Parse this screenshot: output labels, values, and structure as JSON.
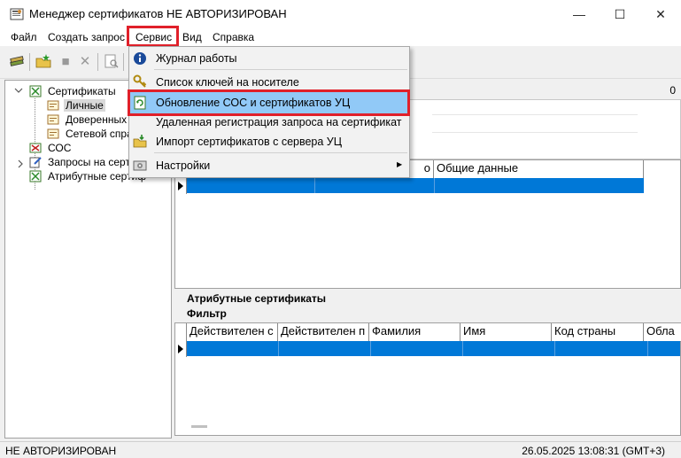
{
  "window": {
    "title": "Менеджер сертификатов  НЕ АВТОРИЗИРОВАН",
    "minimize": "—",
    "maximize": "☐",
    "close": "✕"
  },
  "menubar": [
    "Файл",
    "Создать запрос",
    "Сервис",
    "Вид",
    "Справка"
  ],
  "tree": {
    "items": [
      {
        "label": "Сертификаты",
        "icon": "certificate-folder-icon"
      },
      {
        "label": "Личные",
        "icon": "certificate-icon"
      },
      {
        "label": "Доверенных У",
        "icon": "certificate-icon"
      },
      {
        "label": "Сетевой справ",
        "icon": "certificate-icon"
      },
      {
        "label": "СОС",
        "icon": "crl-icon"
      },
      {
        "label": "Запросы на серти",
        "icon": "request-icon"
      },
      {
        "label": "Атрибутные сертиф",
        "icon": "attr-certificate-icon"
      }
    ]
  },
  "top_panel": {
    "count": "0",
    "partial_header": "о",
    "general_data_header": "Общие данные"
  },
  "attr_section": {
    "title": "Атрибутные сертификаты",
    "filter": "Фильтр",
    "columns": [
      "Действителен с",
      "Действителен п",
      "Фамилия",
      "Имя",
      "Код страны",
      "Обла"
    ]
  },
  "dropdown": {
    "items": [
      {
        "label": "Журнал работы",
        "icon": "info-icon"
      },
      {
        "label": "Список ключей на носителе",
        "icon": "key-icon"
      },
      {
        "label": "Обновление СОС и сертификатов УЦ",
        "icon": "refresh-certificate-icon"
      },
      {
        "label": "Удаленная регистрация запроса на сертификат",
        "icon": ""
      },
      {
        "label": "Импорт сертификатов с сервера УЦ",
        "icon": "import-folder-icon"
      },
      {
        "label": "Настройки",
        "icon": "settings-icon",
        "submenu": "▶"
      }
    ]
  },
  "status": {
    "left": "НЕ АВТОРИЗИРОВАН",
    "right": "26.05.2025 13:08:31 (GMT+3)"
  },
  "colors": {
    "selection": "#0078d7",
    "highlight_box": "#e0202a",
    "menu_hover": "#91c9f7"
  }
}
